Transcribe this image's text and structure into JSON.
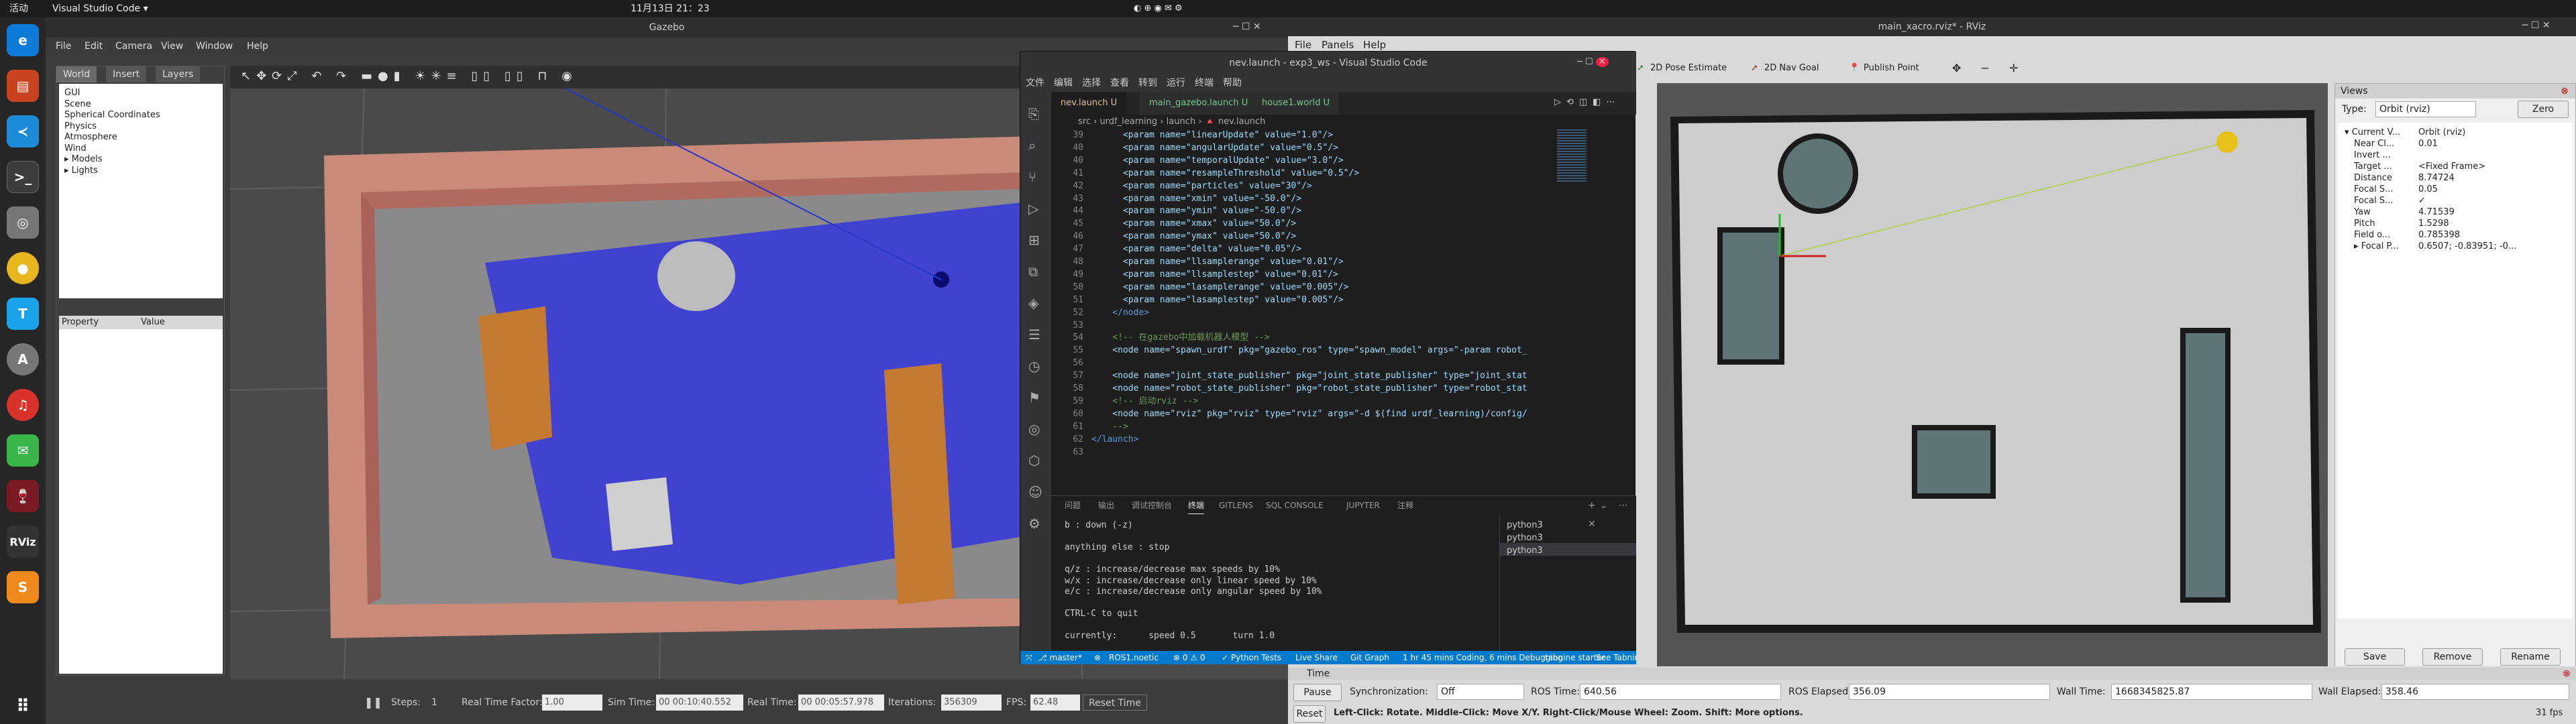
{
  "topbar": {
    "activities": "活动",
    "app": "Visual Studio Code ▾",
    "clock": "11月13日  21：23"
  },
  "dock": {
    "icons": [
      "edge-icon",
      "files-icon",
      "vscode-icon",
      "terminal-icon",
      "disks-icon",
      "chrome-icon",
      "typora-icon",
      "software-icon",
      "netease-music-icon",
      "wechat-icon",
      "wine-icon",
      "rviz-icon",
      "sublime-icon",
      "apps-grid-icon"
    ]
  },
  "gazebo": {
    "title": "Gazebo",
    "menu": [
      "File",
      "Edit",
      "Camera",
      "View",
      "Window",
      "Help"
    ],
    "tabs": [
      "World",
      "Insert",
      "Layers"
    ],
    "tree": [
      "GUI",
      "Scene",
      "Spherical Coordinates",
      "Physics",
      "Atmosphere",
      "Wind",
      "▸ Models",
      "▸ Lights"
    ],
    "prop_headers": [
      "Property",
      "Value"
    ],
    "status": {
      "steps_label": "Steps:",
      "steps_value": "1",
      "rtf_label": "Real Time Factor:",
      "rtf_value": "1.00",
      "sim_label": "Sim Time:",
      "sim_value": "00 00:10:40.552",
      "real_label": "Real Time:",
      "real_value": "00 00:05:57.978",
      "iter_label": "Iterations:",
      "iter_value": "356309",
      "fps_label": "FPS:",
      "fps_value": "62.48",
      "reset_label": "Reset Time"
    }
  },
  "vscode": {
    "title": "nev.launch - exp3_ws - Visual Studio Code",
    "menu": [
      "文件",
      "编辑",
      "选择",
      "查看",
      "转到",
      "运行",
      "终端",
      "帮助"
    ],
    "tabs": [
      "nev.launch U",
      "main_gazebo.launch U",
      "house1.world U"
    ],
    "breadcrumb": "src › urdf_learning › launch › 🔺 nev.launch",
    "lines": [
      {
        "n": "39",
        "t": "      <param name=\"linearUpdate\" value=\"1.0\"/>"
      },
      {
        "n": "40",
        "t": "      <param name=\"angularUpdate\" value=\"0.5\"/>"
      },
      {
        "n": "40",
        "t": "      <param name=\"temporalUpdate\" value=\"3.0\"/>"
      },
      {
        "n": "41",
        "t": "      <param name=\"resampleThreshold\" value=\"0.5\"/>"
      },
      {
        "n": "42",
        "t": "      <param name=\"particles\" value=\"30\"/>"
      },
      {
        "n": "43",
        "t": "      <param name=\"xmin\" value=\"-50.0\"/>"
      },
      {
        "n": "44",
        "t": "      <param name=\"ymin\" value=\"-50.0\"/>"
      },
      {
        "n": "45",
        "t": "      <param name=\"xmax\" value=\"50.0\"/>"
      },
      {
        "n": "46",
        "t": "      <param name=\"ymax\" value=\"50.0\"/>"
      },
      {
        "n": "47",
        "t": "      <param name=\"delta\" value=\"0.05\"/>"
      },
      {
        "n": "48",
        "t": "      <param name=\"llsamplerange\" value=\"0.01\"/>"
      },
      {
        "n": "49",
        "t": "      <param name=\"llsamplestep\" value=\"0.01\"/>"
      },
      {
        "n": "50",
        "t": "      <param name=\"lasamplerange\" value=\"0.005\"/>"
      },
      {
        "n": "51",
        "t": "      <param name=\"lasamplestep\" value=\"0.005\"/>"
      },
      {
        "n": "52",
        "t": "    </node>"
      },
      {
        "n": "53",
        "t": ""
      },
      {
        "n": "54",
        "t": "    <!-- 在gazebo中加载机器人模型 -->"
      },
      {
        "n": "55",
        "t": "    <node name=\"spawn_urdf\" pkg=\"gazebo_ros\" type=\"spawn_model\" args=\"-param robot_"
      },
      {
        "n": "56",
        "t": ""
      },
      {
        "n": "57",
        "t": "    <node name=\"joint_state_publisher\" pkg=\"joint_state_publisher\" type=\"joint_stat"
      },
      {
        "n": "58",
        "t": "    <node name=\"robot_state_publisher\" pkg=\"robot_state_publisher\" type=\"robot_stat"
      },
      {
        "n": "59",
        "t": "    <!-- 启动rviz -->"
      },
      {
        "n": "60",
        "t": "    <node name=\"rviz\" pkg=\"rviz\" type=\"rviz\" args=\"-d $(find urdf_learning)/config/"
      },
      {
        "n": "61",
        "t": "    -->"
      },
      {
        "n": "62",
        "t": "</launch>"
      },
      {
        "n": "63",
        "t": ""
      }
    ],
    "term_tabs": [
      "问题",
      "输出",
      "调试控制台",
      "终端",
      "GITLENS",
      "SQL CONSOLE",
      "JUPYTER",
      "注释"
    ],
    "term_text": "b : down (-z)\n\nanything else : stop\n\nq/z : increase/decrease max speeds by 10%\nw/x : increase/decrease only linear speed by 10%\ne/c : increase/decrease only angular speed by 10%\n\nCTRL-C to quit\n\ncurrently:      speed 0.5       turn 1.0",
    "term_list": [
      "python3",
      "python3",
      "python3"
    ],
    "status": [
      "⎇ master*",
      "⊗",
      "ROS1.noetic",
      "⊗ 0 ⚠ 0",
      "✓ Python Tests",
      "Live Share",
      "Git Graph",
      "1 hr 45 mins Coding, 6 mins Debugging",
      "tabnine starter",
      "See Tabnine"
    ]
  },
  "rviz": {
    "title": "main_xacro.rviz* - RViz",
    "menu": [
      "File",
      "Panels",
      "Help"
    ],
    "tools": [
      "2D Pose Estimate",
      "2D Nav Goal",
      "Publish Point"
    ],
    "views": {
      "title": "Views",
      "type_label": "Type:",
      "type_value": "Orbit (rviz)",
      "zero": "Zero",
      "rows": [
        [
          "▾ Current V...",
          "Orbit (rviz)"
        ],
        [
          "Near Cl...",
          "0.01"
        ],
        [
          "Invert ...",
          ""
        ],
        [
          "Target ...",
          "<Fixed Frame>"
        ],
        [
          "Distance",
          "8.74724"
        ],
        [
          "Focal S...",
          "0.05"
        ],
        [
          "Focal S...",
          "✓"
        ],
        [
          "Yaw",
          "4.71539"
        ],
        [
          "Pitch",
          "1.5298"
        ],
        [
          "Field o...",
          "0.785398"
        ],
        [
          "▸ Focal P...",
          "0.6507; -0.83951; -0..."
        ]
      ],
      "buttons": [
        "Save",
        "Remove",
        "Rename"
      ]
    },
    "time": {
      "title": "Time",
      "pause": "Pause",
      "sync_label": "Synchronization:",
      "sync_value": "Off",
      "ros_time_label": "ROS Time:",
      "ros_time": "640.56",
      "ros_elapsed_label": "ROS Elapsed:",
      "ros_elapsed": "356.09",
      "wall_time_label": "Wall Time:",
      "wall_time": "1668345825.87",
      "wall_elapsed_label": "Wall Elapsed:",
      "wall_elapsed": "358.46"
    },
    "reset": "Reset",
    "hint": "Left-Click: Rotate.  Middle-Click: Move X/Y.  Right-Click/Mouse Wheel: Zoom.  Shift: More options.",
    "fps": "31 fps"
  }
}
